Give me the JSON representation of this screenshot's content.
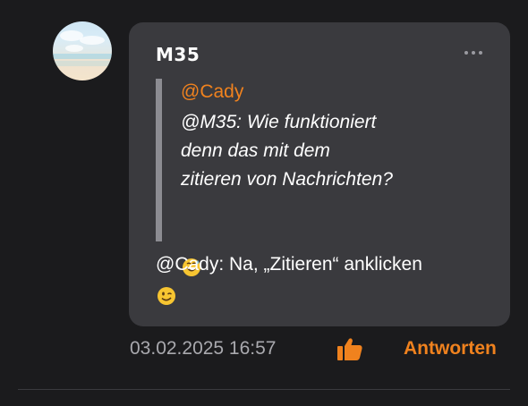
{
  "post": {
    "username": "M35",
    "avatar_icon": "beach-sky-avatar",
    "more_icon": "more-options-icon",
    "quote": {
      "mention": "@Cady",
      "lines": [
        "@M35: Wie funktioniert",
        "denn das mit dem",
        "zitieren von Nachrichten?"
      ],
      "emoji": "grinning-sweat-emoji"
    },
    "reply": {
      "text": "@Cady: Na, „Zitieren“ anklicken",
      "emoji": "winking-face-emoji"
    },
    "timestamp": "03.02.2025 16:57",
    "like_icon": "thumbs-up-icon",
    "reply_button_label": "Antworten"
  },
  "colors": {
    "background": "#1b1b1d",
    "bubble": "#3a3a3e",
    "accent": "#f0821e",
    "quote_bar": "#8c8c92",
    "meta_text": "#a9a9ae"
  }
}
